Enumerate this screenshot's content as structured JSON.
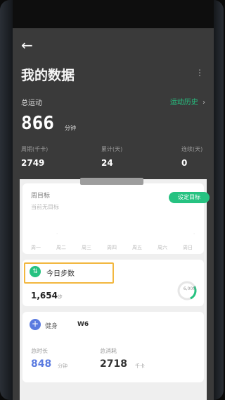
{
  "header": {
    "back_glyph": "←",
    "title": "我的数据",
    "more_glyph": "⋮"
  },
  "summary": {
    "label": "总运动",
    "history_link": "运动历史",
    "total_value": "866",
    "total_unit": "分钟",
    "stats": [
      {
        "label": "周期(千卡)",
        "value": "2749"
      },
      {
        "label": "累计(天)",
        "value": "24"
      },
      {
        "label": "连续(天)",
        "value": "0"
      }
    ]
  },
  "goal_card": {
    "label": "周目标",
    "subtitle": "当前无目标",
    "button": "设定目标",
    "weekdays": [
      "周一",
      "周二",
      "周三",
      "周四",
      "周五",
      "周六",
      "周日"
    ]
  },
  "steps_card": {
    "icon": "⇅",
    "label": "今日步数",
    "value": "1,654",
    "unit": "步",
    "gauge_label": "6,000"
  },
  "fitness_card": {
    "icon": "+",
    "label": "健身",
    "code": "W6",
    "time_label": "总时长",
    "time_value": "848",
    "time_unit": "分钟",
    "cal_label": "总消耗",
    "cal_value": "2718",
    "cal_unit": "千卡"
  },
  "colors": {
    "accent_green": "#26c281",
    "highlight": "#f2b73f",
    "fitness_blue": "#5b7be0"
  },
  "icons": [
    "back-arrow-icon",
    "more-icon",
    "chevron-right-icon",
    "steps-icon",
    "plus-icon"
  ]
}
